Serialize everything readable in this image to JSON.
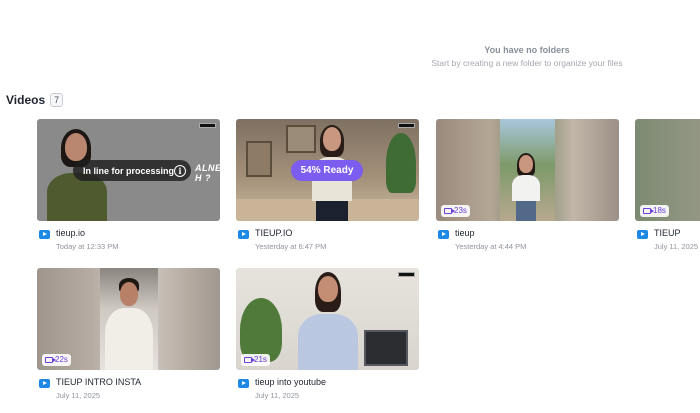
{
  "folders": {
    "empty_title": "You have no folders",
    "empty_subtitle": "Start by creating a new folder to organize your files"
  },
  "videos_section": {
    "title": "Videos",
    "count": "7"
  },
  "videos": [
    {
      "title": "tieup.io",
      "date": "Today at 12:33 PM",
      "status": "In line for processing",
      "overlay_caption": "ALNE H ?",
      "icon": "info-icon"
    },
    {
      "title": "TIEUP.IO",
      "date": "Yesterday at 6:47 PM",
      "status": "54% Ready",
      "progress_percent": 54
    },
    {
      "title": "tieup",
      "date": "Yesterday at 4:44 PM",
      "duration": "23s"
    },
    {
      "title": "TIEUP",
      "date": "July 11, 2025",
      "duration": "18s"
    },
    {
      "title": "TIEUP INTRO INSTA",
      "date": "July 11, 2025",
      "duration": "22s"
    },
    {
      "title": "tieup into youtube",
      "date": "July 11, 2025",
      "duration": "21s"
    }
  ],
  "colors": {
    "accent_purple": "#7d5cf0",
    "video_icon_blue": "#1e88e5",
    "duration_text": "#6d3fd9"
  }
}
